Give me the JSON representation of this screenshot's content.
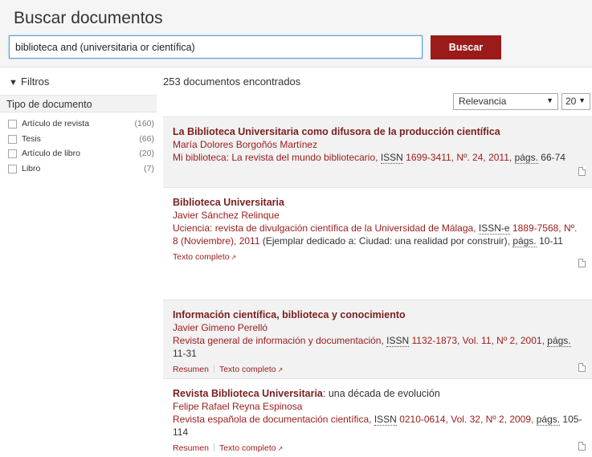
{
  "header": {
    "title": "Buscar documentos",
    "query": "biblioteca and (universitaria or científica)",
    "search_button": "Buscar"
  },
  "sidebar": {
    "filters_label": "Filtros",
    "group_title": "Tipo de documento",
    "facets": [
      {
        "label": "Artículo de revista",
        "count": "(160)"
      },
      {
        "label": "Tesis",
        "count": "(66)"
      },
      {
        "label": "Artículo de libro",
        "count": "(20)"
      },
      {
        "label": "Libro",
        "count": "(7)"
      }
    ]
  },
  "results_summary": "253 documentos encontrados",
  "controls": {
    "sort": "Relevancia",
    "per_page": "20"
  },
  "icons": {
    "filter": "filter-funnel-icon",
    "document": "document-icon",
    "external_link": "external-link-icon",
    "dropdown": "caret-down-icon"
  },
  "colors": {
    "accent": "#9b1b1b",
    "title": "#7a1f1f",
    "shaded_row": "#f2f2f2"
  },
  "results": [
    {
      "title": "La Biblioteca Universitaria como difusora de la producción científica",
      "title_rest": "",
      "authors": "María Dolores Borgoñós Martínez",
      "source_before": "Mi biblioteca: La revista del mundo bibliotecario,",
      "issn_label": "ISSN",
      "source_after": "1699-3411, Nº. 24, 2011,",
      "pags_label": "págs.",
      "pages": "66-74",
      "links": []
    },
    {
      "title": "Biblioteca Universitaria",
      "title_rest": "",
      "authors": "Javier Sánchez Relinque",
      "source_before": "Uciencia: revista de divulgación científica de la Universidad de Málaga,",
      "issn_label": "ISSN-e",
      "source_after": "1889-7568, Nº. 8 (Noviembre), 2011",
      "source_extra": "(Ejemplar dedicado a: Ciudad: una realidad por construir),",
      "pags_label": "págs.",
      "pages": "10-11",
      "links": [
        "Texto completo"
      ]
    },
    {
      "title": "Información científica, biblioteca y conocimiento",
      "title_rest": "",
      "authors": "Javier Gimeno Perelló",
      "source_before": "Revista general de información y documentación,",
      "issn_label": "ISSN",
      "source_after": "1132-1873, Vol. 11, Nº 2, 2001,",
      "pags_label": "págs.",
      "pages": "11-31",
      "links": [
        "Resumen",
        "Texto completo"
      ]
    },
    {
      "title": "Revista Biblioteca Universitaria",
      "title_rest": ": una década de evolución",
      "authors": "Felipe Rafael Reyna Espinosa",
      "source_before": "Revista española de documentación científica,",
      "issn_label": "ISSN",
      "source_after": "0210-0614, Vol. 32, Nº 2, 2009,",
      "pags_label": "págs.",
      "pages": "105-114",
      "links": [
        "Resumen",
        "Texto completo"
      ]
    }
  ]
}
